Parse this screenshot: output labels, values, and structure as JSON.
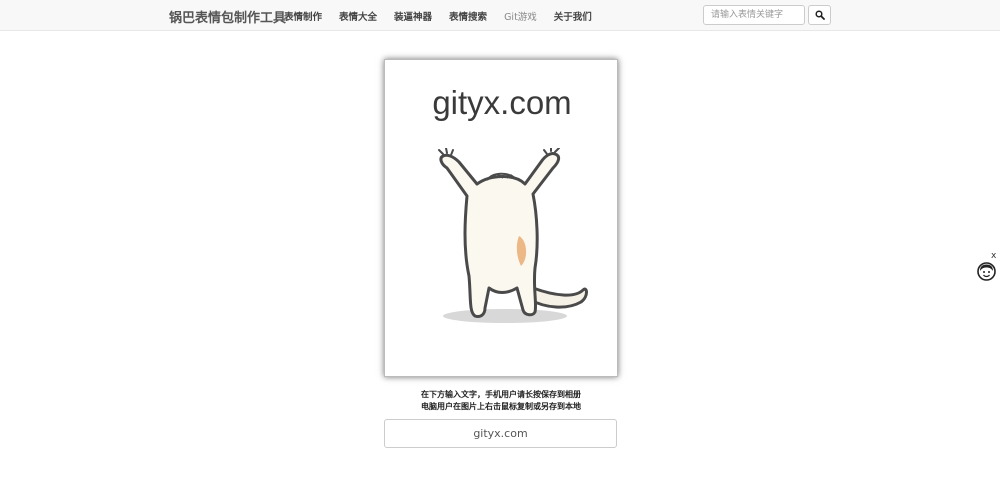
{
  "navbar": {
    "brand": "锅巴表情包制作工具",
    "links": [
      {
        "label": "表情制作",
        "muted": false
      },
      {
        "label": "表情大全",
        "muted": false
      },
      {
        "label": "装逼神器",
        "muted": false
      },
      {
        "label": "表情搜索",
        "muted": false
      },
      {
        "label": "Git游戏",
        "muted": true
      },
      {
        "label": "关于我们",
        "muted": false
      }
    ],
    "search_placeholder": "请输入表情关键字",
    "search_icon": "search-icon"
  },
  "meme": {
    "caption": "gityx.com",
    "image": "dancing-cat-icon"
  },
  "instructions": {
    "line1": "在下方输入文字，手机用户请长按保存到相册",
    "line2": "电脑用户在图片上右击鼠标复制或另存到本地"
  },
  "caption_input": {
    "value": "gityx.com"
  },
  "widget": {
    "close_label": "x",
    "icon": "mascot-face-icon"
  }
}
